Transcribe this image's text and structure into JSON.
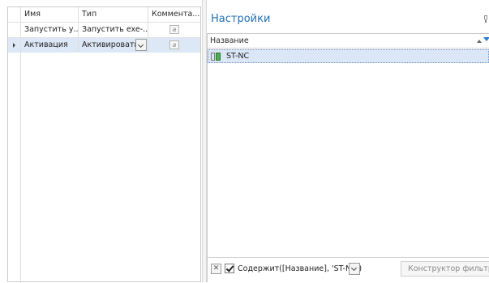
{
  "left_grid": {
    "columns": [
      "Имя",
      "Тип",
      "Коммента..."
    ],
    "rows": [
      {
        "name": "Запустить у...",
        "type": "Запустить exe-...",
        "comment_icon": "a"
      },
      {
        "name": "Активация",
        "type": "Активировать",
        "comment_icon": "a",
        "selected": true
      }
    ]
  },
  "right_panel": {
    "title": "Настройки",
    "column_header": "Название",
    "items": [
      {
        "label": "ST-NC",
        "icon": "settings-item-icon"
      }
    ],
    "filter": {
      "clear_icon": "✕",
      "enabled": true,
      "expression": "Содержит([Название], 'ST-NC')",
      "builder_label": "Конструктор фильтра..."
    }
  },
  "colors": {
    "accent": "#1f6fb3",
    "selection": "#dbe7f6"
  }
}
